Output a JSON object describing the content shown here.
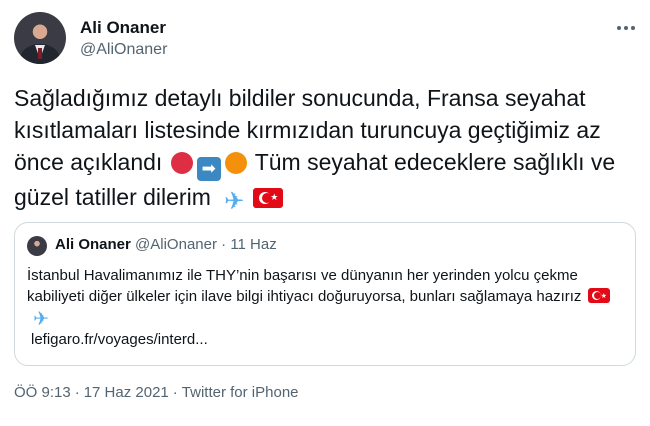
{
  "author": {
    "name": "Ali Onaner",
    "handle": "@AliOnaner"
  },
  "tweet": {
    "text_1": "Sağladığımız detaylı bildiler sonucunda, Fransa seyahat kısıtlamaları listesinde kırmızıdan turuncuya geçtiğimiz az önce açıklandı",
    "text_2": "Tüm seyahat edeceklere sağlıklı ve güzel tatiller dilerim",
    "emoji": [
      "red-circle",
      "right-arrow",
      "orange-circle",
      "airplane",
      "turkey-flag"
    ]
  },
  "quoted": {
    "name": "Ali Onaner",
    "handle": "@AliOnaner",
    "separator": "·",
    "date": "11 Haz",
    "text": "İstanbul Havalimanımız ile THY’nin başarısı ve dünyanın her yerinden yolcu çekme kabiliyeti diğer ülkeler için ilave bilgi ihtiyacı doğuruyorsa, bunları sağlamaya hazırız",
    "link": "lefigaro.fr/voyages/interd..."
  },
  "footer": {
    "time": "ÖÖ 9:13",
    "separator": "·",
    "date": "17 Haz 2021",
    "source": "Twitter for iPhone"
  },
  "colors": {
    "text": "#0f1419",
    "secondary": "#536471",
    "border": "#cfd9de"
  }
}
